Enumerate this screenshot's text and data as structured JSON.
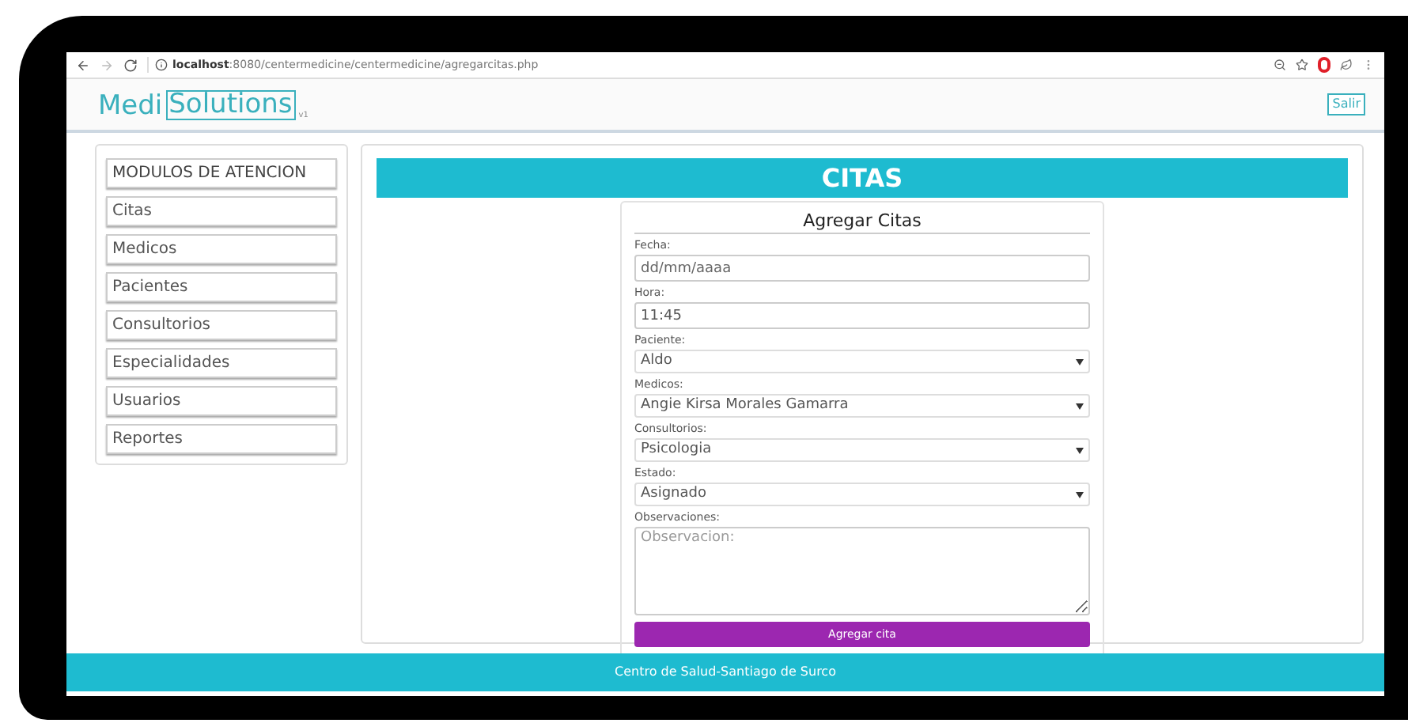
{
  "browser": {
    "url_host": "localhost",
    "url_path": ":8080/centermedicine/centermedicine/agregarcitas.php"
  },
  "header": {
    "logo_left": "Medi",
    "logo_right": "Solutions",
    "version": "v1",
    "logout_button": "Salir"
  },
  "sidebar": {
    "heading": "MODULOS DE ATENCION",
    "items": [
      "Citas",
      "Medicos",
      "Pacientes",
      "Consultorios",
      "Especialidades",
      "Usuarios",
      "Reportes"
    ]
  },
  "page_title": "CITAS",
  "form": {
    "title": "Agregar Citas",
    "fields": [
      {
        "kind": "input",
        "label": "Fecha:",
        "placeholder": "dd/mm/aaaa"
      },
      {
        "kind": "input",
        "label": "Hora:",
        "value": "11:45"
      },
      {
        "kind": "select",
        "label": "Paciente:",
        "value": "Aldo"
      },
      {
        "kind": "select",
        "label": "Medicos:",
        "value": "Angie Kirsa Morales Gamarra"
      },
      {
        "kind": "select",
        "label": "Consultorios:",
        "value": "Psicologia"
      },
      {
        "kind": "select",
        "label": "Estado:",
        "value": "Asignado"
      },
      {
        "kind": "textarea",
        "label": "Observaciones:",
        "placeholder": "Observacion:"
      }
    ],
    "submit": "Agregar cita"
  },
  "footer": "Centro de Salud-Santiago de Surco"
}
